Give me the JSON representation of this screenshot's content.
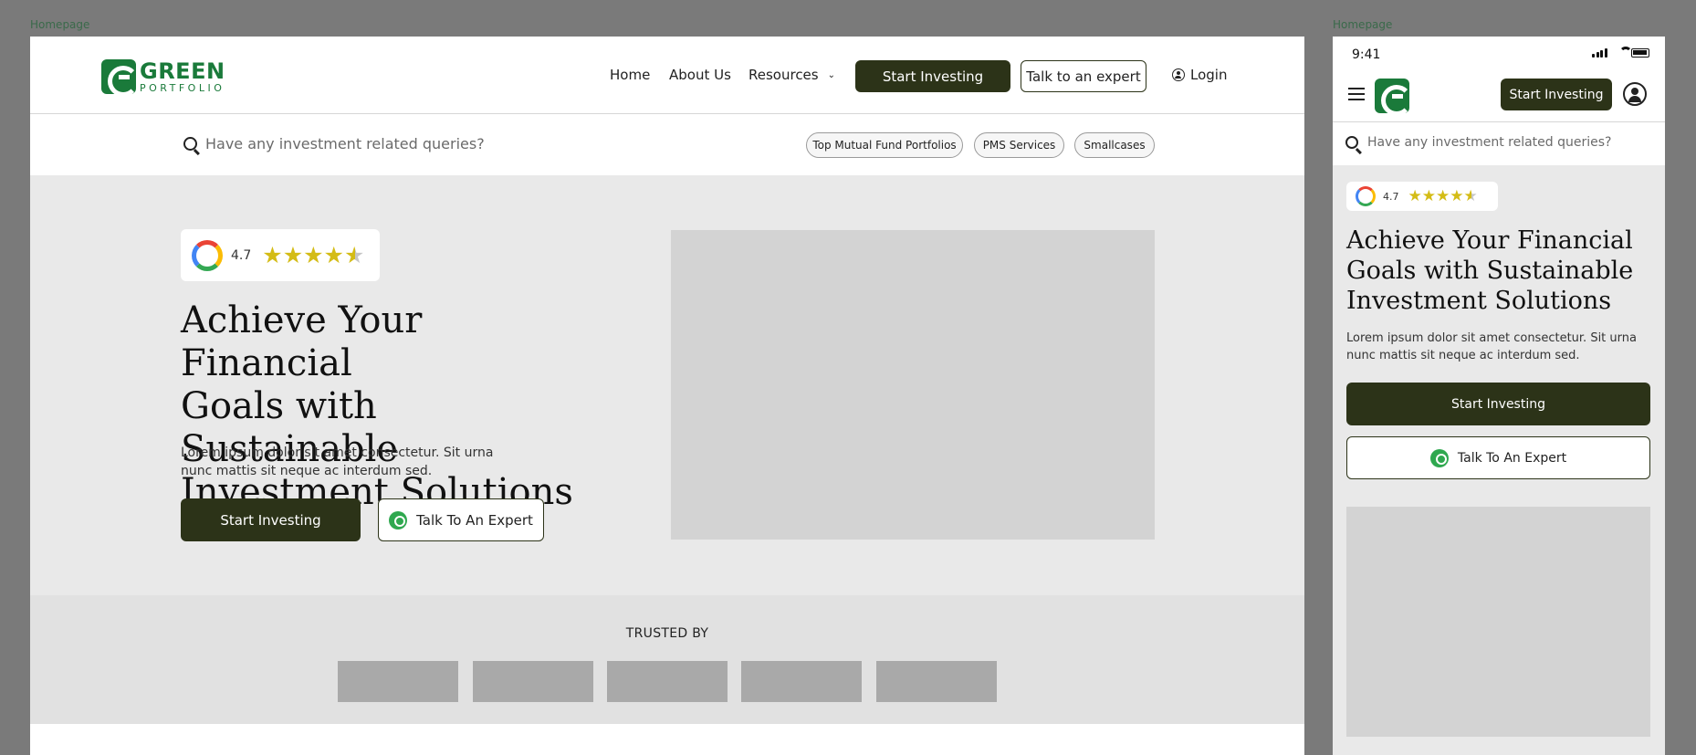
{
  "frames": {
    "desktop_label": "Homepage",
    "mobile_label": "Homepage"
  },
  "brand": {
    "name_line1": "GREEN",
    "name_line2": "PORTFOLIO",
    "color": "#1a7a3a",
    "dark_button_color": "#2c3318"
  },
  "nav": {
    "home": "Home",
    "about": "About Us",
    "resources": "Resources",
    "start_investing": "Start Investing",
    "talk_expert": "Talk to an expert",
    "login": "Login"
  },
  "search": {
    "placeholder": "Have any investment related queries?",
    "chips": [
      "Top Mutual Fund Portfolios",
      "PMS Services",
      "Smallcases"
    ]
  },
  "rating": {
    "value": "4.7",
    "stars_filled": 4.5,
    "stars_total": 5
  },
  "hero": {
    "title_lines": [
      "Achieve Your Financial",
      "Goals with Sustainable",
      "Investment Solutions"
    ],
    "subtitle": "Lorem ipsum dolor sit amet consectetur. Sit urna nunc mattis sit neque ac interdum sed.",
    "primary_cta": "Start Investing",
    "secondary_cta": "Talk To An Expert"
  },
  "trusted": {
    "label": "TRUSTED BY",
    "logo_count": 5
  },
  "mobile": {
    "status_time": "9:41",
    "header_cta": "Start Investing"
  },
  "icons": {
    "search": "search-icon",
    "user": "user-circle-icon",
    "menu": "hamburger-menu-icon",
    "whatsapp": "whatsapp-icon",
    "google": "google-icon",
    "chevron": "chevron-down-icon"
  }
}
